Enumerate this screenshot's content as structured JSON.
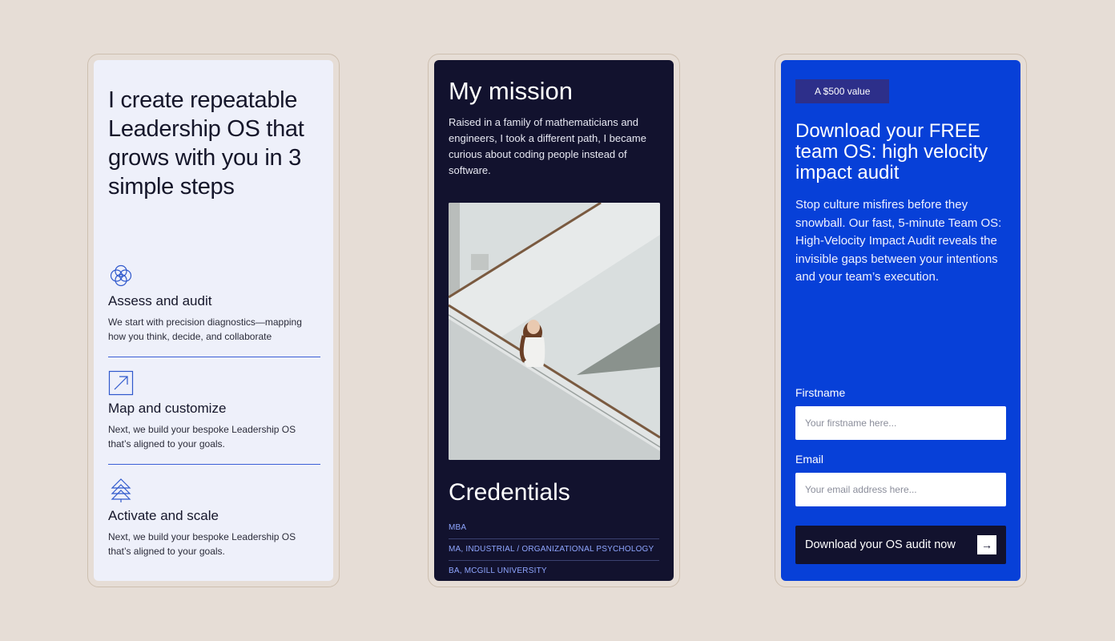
{
  "steps_card": {
    "heading": "I create repeatable Leadership OS that grows with you in 3 simple steps",
    "steps": [
      {
        "icon": "interlocking-circles-icon",
        "title": "Assess and audit",
        "description": "We start with precision diagnostics—mapping how you think, decide, and collaborate"
      },
      {
        "icon": "arrow-up-right-square-icon",
        "title": "Map and customize",
        "description": "Next, we build your bespoke Leadership OS that’s aligned to your goals."
      },
      {
        "icon": "stacked-triangles-icon",
        "title": "Activate and scale",
        "description": "Next, we build your bespoke Leadership OS that’s aligned to your goals."
      }
    ]
  },
  "mission_card": {
    "title": "My mission",
    "text": "Raised in a family of mathematicians and engineers, I took a different path, I became curious about coding people instead of software.",
    "credentials_title": "Credentials",
    "credentials": [
      "MBA",
      "MA, Industrial / Organizational Psychology",
      "BA, McGill University"
    ]
  },
  "audit_card": {
    "badge": "A $500 value",
    "title": "Download your FREE team OS: high velocity impact audit",
    "text": "Stop culture misfires before they snowball. Our fast, 5-minute Team OS: High-Velocity Impact Audit reveals the invisible gaps between your intentions and your team’s execution.",
    "form": {
      "firstname_label": "Firstname",
      "firstname_placeholder": "Your firstname here...",
      "email_label": "Email",
      "email_placeholder": "Your email address here...",
      "submit_label": "Download your OS audit now"
    }
  },
  "colors": {
    "page_background": "#e6ddd6",
    "steps_card_background": "#eef0fa",
    "mission_card_background": "#12122e",
    "audit_card_background": "#0740d8",
    "accent_blue": "#3b5fd6",
    "credential_text": "#8fa6ff"
  }
}
